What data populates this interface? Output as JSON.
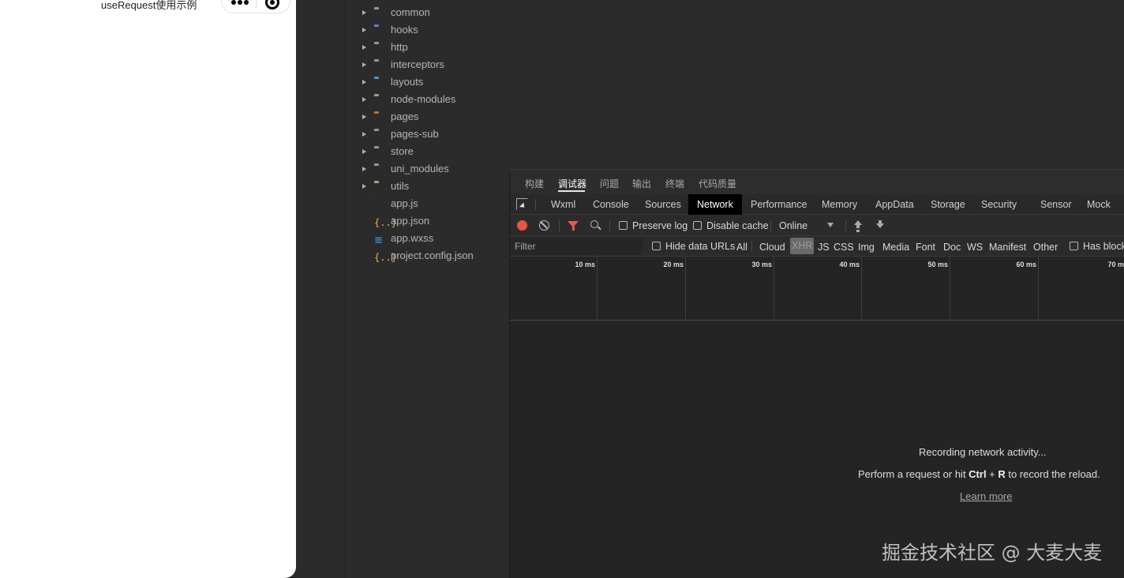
{
  "simulator": {
    "page_title": "useRequest使用示例"
  },
  "explorer": {
    "items": [
      {
        "label": "common",
        "type": "folder",
        "color": "#8a9aac"
      },
      {
        "label": "hooks",
        "type": "folder",
        "color": "#5d7fc4"
      },
      {
        "label": "http",
        "type": "folder",
        "color": "#8a9aac"
      },
      {
        "label": "interceptors",
        "type": "folder",
        "color": "#8a9aac"
      },
      {
        "label": "layouts",
        "type": "folder",
        "color": "#3d9ad6"
      },
      {
        "label": "node-modules",
        "type": "folder",
        "color": "#8a9aac"
      },
      {
        "label": "pages",
        "type": "folder",
        "color": "#d9643c"
      },
      {
        "label": "pages-sub",
        "type": "folder",
        "color": "#8a9aac"
      },
      {
        "label": "store",
        "type": "folder",
        "color": "#8a9aac"
      },
      {
        "label": "uni_modules",
        "type": "folder",
        "color": "#8a9aac"
      },
      {
        "label": "utils",
        "type": "folder",
        "color": "#a3a77a"
      },
      {
        "label": "app.js",
        "type": "js"
      },
      {
        "label": "app.json",
        "type": "json"
      },
      {
        "label": "app.wxss",
        "type": "css"
      },
      {
        "label": "project.config.json",
        "type": "json"
      }
    ]
  },
  "devtools": {
    "top_tabs": [
      "构建",
      "调试器",
      "问题",
      "输出",
      "终端",
      "代码质量"
    ],
    "active_top_tab": "调试器",
    "panel_tabs": [
      "Wxml",
      "Console",
      "Sources",
      "Network",
      "Performance",
      "Memory",
      "AppData",
      "Storage",
      "Security",
      "Sensor",
      "Mock"
    ],
    "active_panel_tab": "Network",
    "toolbar": {
      "preserve_log": "Preserve log",
      "disable_cache": "Disable cache",
      "throttling": "Online"
    },
    "filterbar": {
      "placeholder": "Filter",
      "hide_data_urls": "Hide data URLs",
      "types": [
        "All",
        "Cloud",
        "XHR",
        "JS",
        "CSS",
        "Img",
        "Media",
        "Font",
        "Doc",
        "WS",
        "Manifest",
        "Other"
      ],
      "active_type": "XHR",
      "has_blocked": "Has block"
    },
    "timeline_ticks": [
      "10 ms",
      "20 ms",
      "30 ms",
      "40 ms",
      "50 ms",
      "60 ms",
      "70 ms"
    ],
    "empty_state": {
      "line1": "Recording network activity...",
      "line2_pre": "Perform a request or hit ",
      "line2_key1": "Ctrl",
      "line2_plus": " + ",
      "line2_key2": "R",
      "line2_post": " to record the reload.",
      "learn_more": "Learn more"
    }
  },
  "watermark": "掘金技术社区 @ 大麦大麦",
  "colors": {
    "record": "#e9553e",
    "filter": "#e65a4d",
    "active_tab_bg": "#000000"
  }
}
